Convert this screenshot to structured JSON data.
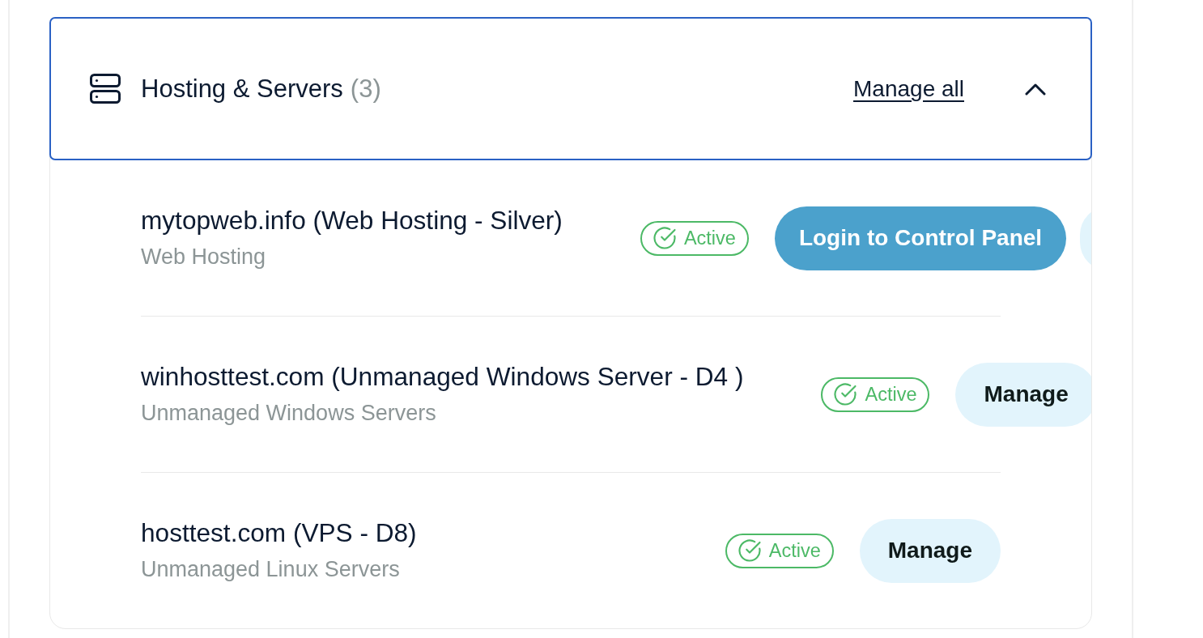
{
  "section": {
    "title": "Hosting & Servers",
    "count": "(3)",
    "link": "Manage all",
    "expanded": true,
    "focused": true
  },
  "services": [
    {
      "name": "mytopweb.info (Web Hosting - Silver)",
      "type": "Web Hosting",
      "status": {
        "kind": "active",
        "label": "Active"
      },
      "actions": [
        {
          "kind": "primary",
          "label": "Login to Control Panel"
        },
        {
          "kind": "secondary"
        }
      ]
    },
    {
      "name": "winhosttest.com (Unmanaged Windows Server - D4 )",
      "type": "Unmanaged Windows Servers",
      "status": {
        "kind": "active",
        "label": "Active"
      },
      "actions": [
        {
          "kind": "secondary",
          "label": "Manage"
        }
      ]
    },
    {
      "name": "hosttest.com (VPS - D8)",
      "type": "Unmanaged Linux Servers",
      "status": {
        "kind": "active",
        "label": "Active"
      },
      "actions": [
        {
          "kind": "secondary",
          "label": "Manage"
        }
      ]
    }
  ]
}
